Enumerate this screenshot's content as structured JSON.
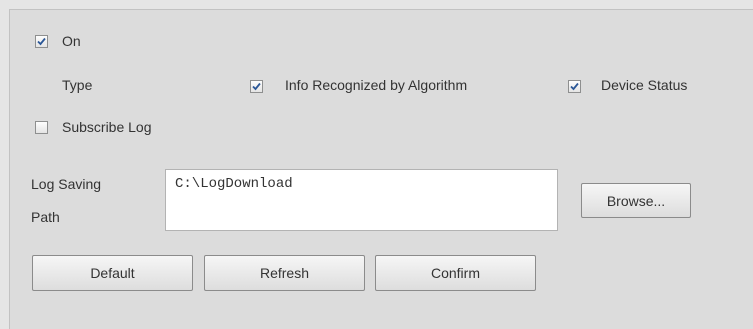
{
  "enable": {
    "label": "On",
    "checked": true
  },
  "type_row": {
    "label": "Type",
    "options": [
      {
        "label": "Info Recognized by Algorithm",
        "checked": true
      },
      {
        "label": "Device Status",
        "checked": true
      }
    ]
  },
  "subscribe": {
    "label": "Subscribe Log",
    "checked": false
  },
  "log_path": {
    "label_line1": "Log Saving",
    "label_line2": "Path",
    "value": "C:\\LogDownload"
  },
  "buttons": {
    "browse": "Browse...",
    "default": "Default",
    "refresh": "Refresh",
    "confirm": "Confirm"
  },
  "colors": {
    "background": "#dcdcdc",
    "checkmark": "#2b5797"
  }
}
